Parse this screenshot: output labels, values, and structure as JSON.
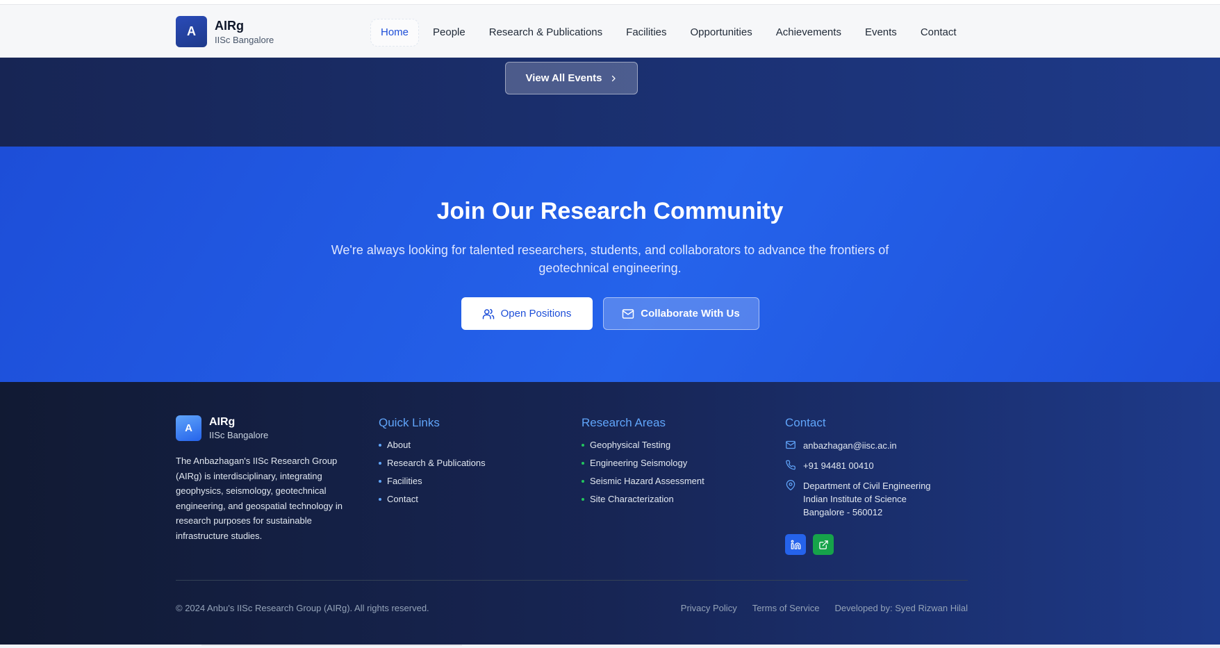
{
  "header": {
    "brand_letter": "A",
    "brand_title": "AIRg",
    "brand_subtitle": "IISc Bangalore",
    "nav": [
      {
        "label": "Home",
        "active": true
      },
      {
        "label": "People"
      },
      {
        "label": "Research & Publications"
      },
      {
        "label": "Facilities"
      },
      {
        "label": "Opportunities"
      },
      {
        "label": "Achievements"
      },
      {
        "label": "Events"
      },
      {
        "label": "Contact"
      }
    ]
  },
  "events": {
    "view_all_label": "View All Events",
    "icon": "chevron-right-icon"
  },
  "join": {
    "title": "Join Our Research Community",
    "description": "We're always looking for talented researchers, students, and collaborators to advance the frontiers of geotechnical engineering.",
    "primary_button": {
      "label": "Open Positions",
      "icon": "users-icon"
    },
    "secondary_button": {
      "label": "Collaborate With Us",
      "icon": "mail-icon"
    }
  },
  "footer": {
    "brand_letter": "A",
    "brand_title": "AIRg",
    "brand_subtitle": "IISc Bangalore",
    "about": "The Anbazhagan's IISc Research Group (AIRg) is interdisciplinary, integrating geophysics, seismology, geotechnical engineering, and geospatial technology in research purposes for sustainable infrastructure studies.",
    "quick_links": {
      "title": "Quick Links",
      "items": [
        "About",
        "Research & Publications",
        "Facilities",
        "Contact"
      ]
    },
    "research_areas": {
      "title": "Research Areas",
      "items": [
        "Geophysical Testing",
        "Engineering Seismology",
        "Seismic Hazard Assessment",
        "Site Characterization"
      ]
    },
    "contact": {
      "title": "Contact",
      "email": "anbazhagan@iisc.ac.in",
      "phone": "+91 94481 00410",
      "address_line1": "Department of Civil Engineering",
      "address_line2": "Indian Institute of Science",
      "address_line3": "Bangalore - 560012"
    },
    "copyright": "© 2024 Anbu's IISc Research Group (AIRg). All rights reserved.",
    "bottom_links": [
      "Privacy Policy",
      "Terms of Service",
      "Developed by: Syed Rizwan Hilal"
    ]
  },
  "colors": {
    "accent": "#1d4ed8",
    "join_bg": "#2563eb",
    "footer_bg": "#172554",
    "link_heading": "#60a5fa",
    "research_bullet": "#22c55e"
  }
}
